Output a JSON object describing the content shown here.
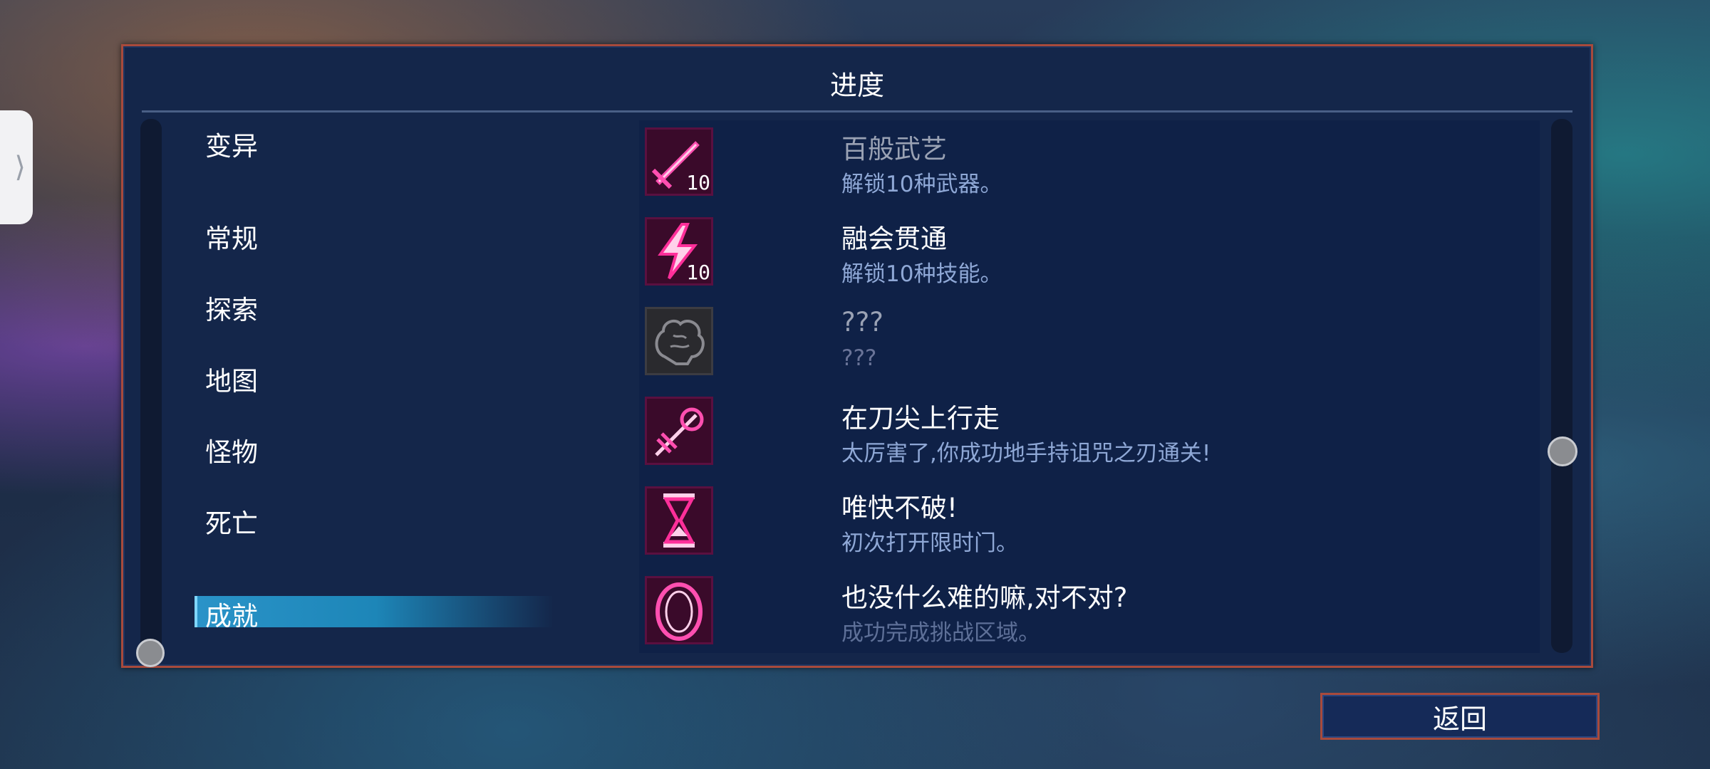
{
  "panel": {
    "title": "进度"
  },
  "categories": [
    {
      "label": "变异"
    },
    {
      "label": "常规"
    },
    {
      "label": "探索"
    },
    {
      "label": "地图"
    },
    {
      "label": "怪物"
    },
    {
      "label": "死亡"
    },
    {
      "label": "成就",
      "active": true
    }
  ],
  "achievements": [
    {
      "title": "百般武艺",
      "desc": "解锁10种武器。",
      "icon": "sword-icon",
      "badge": "10",
      "state": "dim"
    },
    {
      "title": "融会贯通",
      "desc": "解锁10种技能。",
      "icon": "lightning-icon",
      "badge": "10",
      "state": "normal"
    },
    {
      "title": "???",
      "desc": "???",
      "icon": "locked-brain-icon",
      "badge": "",
      "state": "locked"
    },
    {
      "title": "在刀尖上行走",
      "desc": "太厉害了,你成功地手持诅咒之刃通关!",
      "icon": "cursed-blade-icon",
      "badge": "",
      "state": "normal"
    },
    {
      "title": "唯快不破!",
      "desc": "初次打开限时门。",
      "icon": "hourglass-icon",
      "badge": "",
      "state": "normal"
    },
    {
      "title": "也没什么难的嘛,对不对?",
      "desc": "成功完成挑战区域。",
      "icon": "ring-portal-icon",
      "badge": "",
      "state": "faded"
    }
  ],
  "buttons": {
    "back": "返回"
  },
  "colors": {
    "accent": "#e0187a",
    "frame": "#a84a3c",
    "active_tab": "#2a93c8"
  }
}
